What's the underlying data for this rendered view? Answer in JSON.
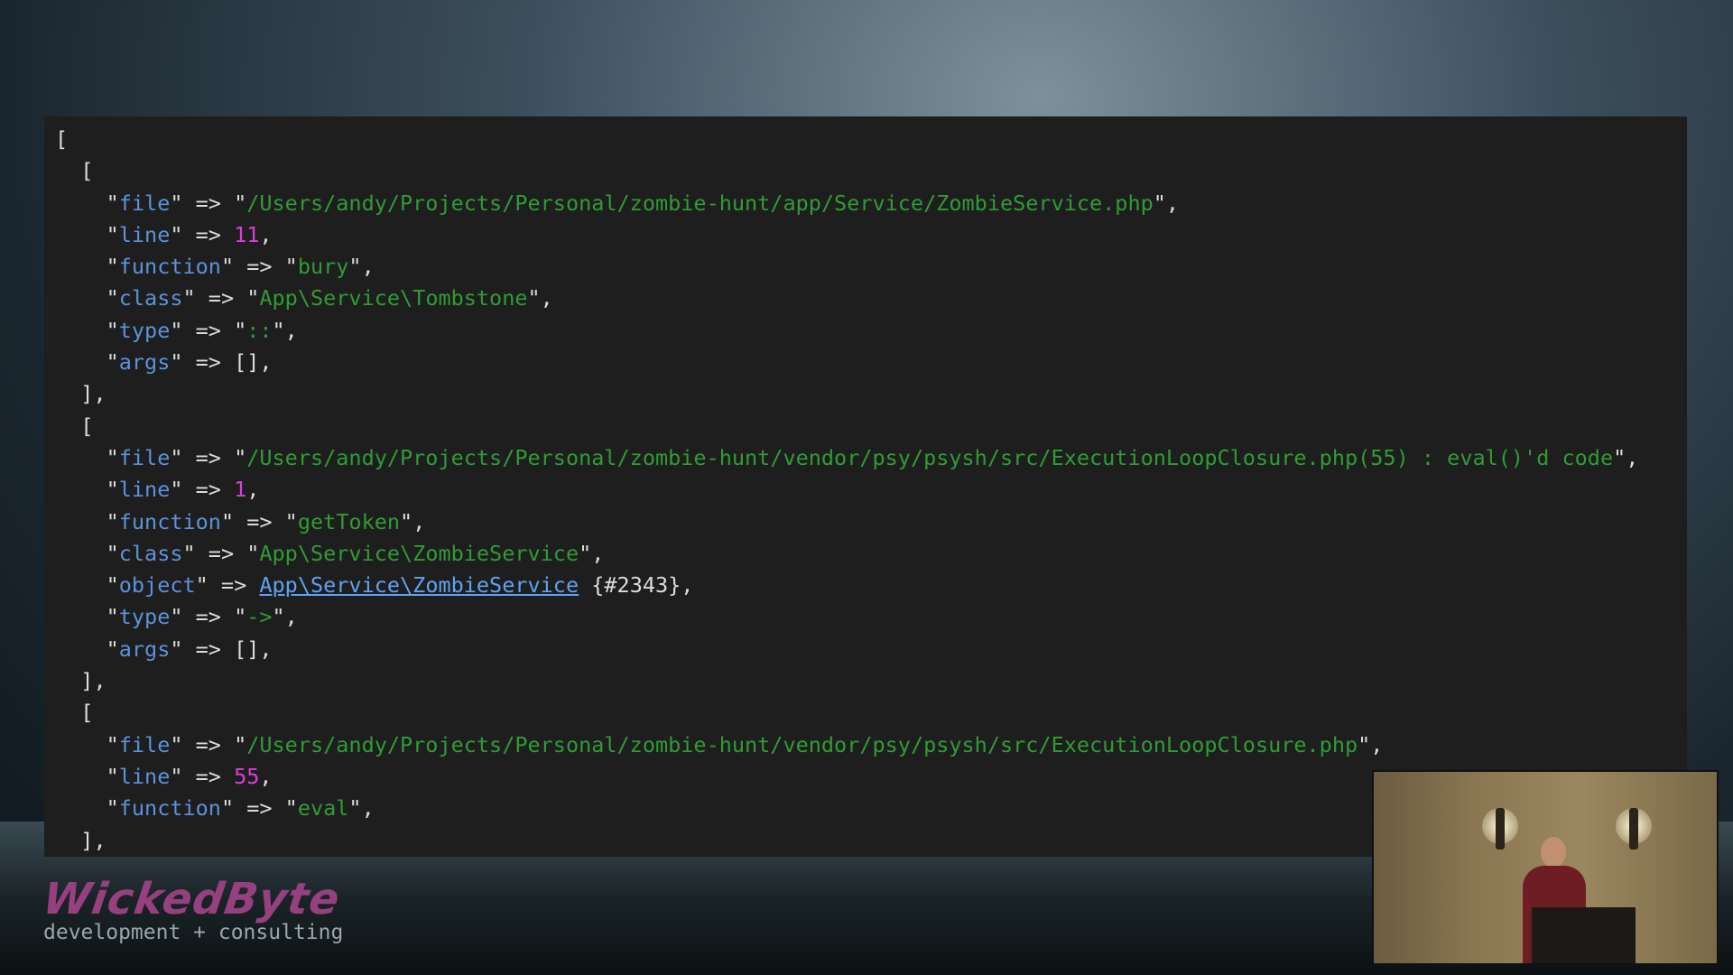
{
  "lines": [
    [
      {
        "t": "[",
        "c": "p"
      }
    ],
    [
      {
        "t": "  [",
        "c": "p"
      }
    ],
    [
      {
        "t": "    \"",
        "c": "p"
      },
      {
        "t": "file",
        "c": "k"
      },
      {
        "t": "\" => \"",
        "c": "p"
      },
      {
        "t": "/Users/andy/Projects/Personal/zombie-hunt/app/Service/ZombieService.php",
        "c": "s"
      },
      {
        "t": "\",",
        "c": "p"
      }
    ],
    [
      {
        "t": "    \"",
        "c": "p"
      },
      {
        "t": "line",
        "c": "k"
      },
      {
        "t": "\" => ",
        "c": "p"
      },
      {
        "t": "11",
        "c": "n"
      },
      {
        "t": ",",
        "c": "p"
      }
    ],
    [
      {
        "t": "    \"",
        "c": "p"
      },
      {
        "t": "function",
        "c": "k"
      },
      {
        "t": "\" => \"",
        "c": "p"
      },
      {
        "t": "bury",
        "c": "s"
      },
      {
        "t": "\",",
        "c": "p"
      }
    ],
    [
      {
        "t": "    \"",
        "c": "p"
      },
      {
        "t": "class",
        "c": "k"
      },
      {
        "t": "\" => \"",
        "c": "p"
      },
      {
        "t": "App\\Service\\Tombstone",
        "c": "s"
      },
      {
        "t": "\",",
        "c": "p"
      }
    ],
    [
      {
        "t": "    \"",
        "c": "p"
      },
      {
        "t": "type",
        "c": "k"
      },
      {
        "t": "\" => \"",
        "c": "p"
      },
      {
        "t": "::",
        "c": "s"
      },
      {
        "t": "\",",
        "c": "p"
      }
    ],
    [
      {
        "t": "    \"",
        "c": "p"
      },
      {
        "t": "args",
        "c": "k"
      },
      {
        "t": "\" => [],",
        "c": "p"
      }
    ],
    [
      {
        "t": "  ],",
        "c": "p"
      }
    ],
    [
      {
        "t": "  [",
        "c": "p"
      }
    ],
    [
      {
        "t": "    \"",
        "c": "p"
      },
      {
        "t": "file",
        "c": "k"
      },
      {
        "t": "\" => \"",
        "c": "p"
      },
      {
        "t": "/Users/andy/Projects/Personal/zombie-hunt/vendor/psy/psysh/src/ExecutionLoopClosure.php(55) : eval()'d code",
        "c": "s"
      },
      {
        "t": "\",",
        "c": "p"
      }
    ],
    [
      {
        "t": "    \"",
        "c": "p"
      },
      {
        "t": "line",
        "c": "k"
      },
      {
        "t": "\" => ",
        "c": "p"
      },
      {
        "t": "1",
        "c": "n"
      },
      {
        "t": ",",
        "c": "p"
      }
    ],
    [
      {
        "t": "    \"",
        "c": "p"
      },
      {
        "t": "function",
        "c": "k"
      },
      {
        "t": "\" => \"",
        "c": "p"
      },
      {
        "t": "getToken",
        "c": "s"
      },
      {
        "t": "\",",
        "c": "p"
      }
    ],
    [
      {
        "t": "    \"",
        "c": "p"
      },
      {
        "t": "class",
        "c": "k"
      },
      {
        "t": "\" => \"",
        "c": "p"
      },
      {
        "t": "App\\Service\\ZombieService",
        "c": "s"
      },
      {
        "t": "\",",
        "c": "p"
      }
    ],
    [
      {
        "t": "    \"",
        "c": "p"
      },
      {
        "t": "object",
        "c": "k"
      },
      {
        "t": "\" => ",
        "c": "p"
      },
      {
        "t": "App\\Service\\ZombieService",
        "c": "l"
      },
      {
        "t": " {#2343},",
        "c": "p"
      }
    ],
    [
      {
        "t": "    \"",
        "c": "p"
      },
      {
        "t": "type",
        "c": "k"
      },
      {
        "t": "\" => \"",
        "c": "p"
      },
      {
        "t": "->",
        "c": "s"
      },
      {
        "t": "\",",
        "c": "p"
      }
    ],
    [
      {
        "t": "    \"",
        "c": "p"
      },
      {
        "t": "args",
        "c": "k"
      },
      {
        "t": "\" => [],",
        "c": "p"
      }
    ],
    [
      {
        "t": "  ],",
        "c": "p"
      }
    ],
    [
      {
        "t": "  [",
        "c": "p"
      }
    ],
    [
      {
        "t": "    \"",
        "c": "p"
      },
      {
        "t": "file",
        "c": "k"
      },
      {
        "t": "\" => \"",
        "c": "p"
      },
      {
        "t": "/Users/andy/Projects/Personal/zombie-hunt/vendor/psy/psysh/src/ExecutionLoopClosure.php",
        "c": "s"
      },
      {
        "t": "\",",
        "c": "p"
      }
    ],
    [
      {
        "t": "    \"",
        "c": "p"
      },
      {
        "t": "line",
        "c": "k"
      },
      {
        "t": "\" => ",
        "c": "p"
      },
      {
        "t": "55",
        "c": "n"
      },
      {
        "t": ",",
        "c": "p"
      }
    ],
    [
      {
        "t": "    \"",
        "c": "p"
      },
      {
        "t": "function",
        "c": "k"
      },
      {
        "t": "\" => \"",
        "c": "p"
      },
      {
        "t": "eval",
        "c": "s"
      },
      {
        "t": "\",",
        "c": "p"
      }
    ],
    [
      {
        "t": "  ],",
        "c": "p"
      }
    ]
  ],
  "colors": {
    "key": "#5b92dc",
    "string": "#2f9c34",
    "number": "#d93fd9",
    "link": "#5fa2f2",
    "background": "#1e1e1e"
  },
  "branding": {
    "logo_text": "WickedByte",
    "tagline": "development + consulting"
  },
  "webcam": {
    "description_icon": "speaker-video-feed"
  }
}
